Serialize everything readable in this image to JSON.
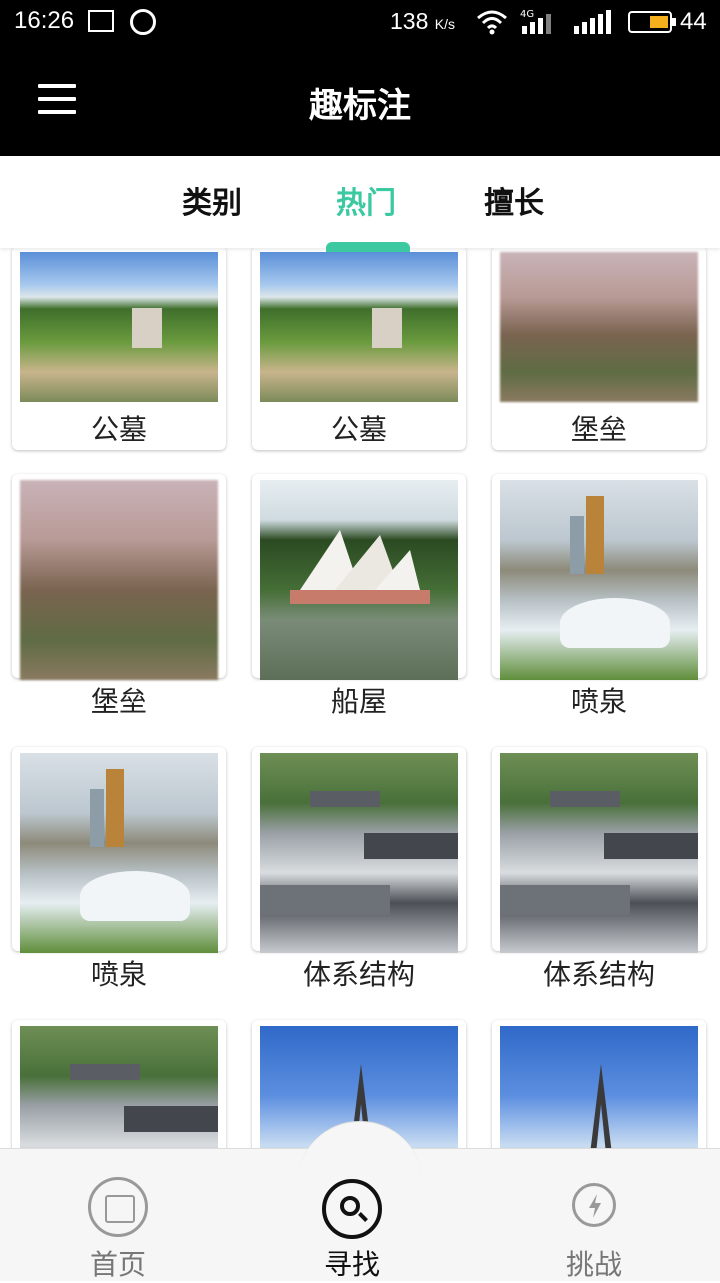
{
  "status_bar": {
    "time": "16:26",
    "network_speed": "138",
    "network_speed_unit": "K/s",
    "network_type": "4G",
    "battery_percent": "44",
    "icons": [
      "image-icon",
      "check-circle-icon",
      "wifi-icon",
      "signal-icon",
      "battery-icon"
    ]
  },
  "app_bar": {
    "title": "趣标注",
    "menu_icon": "hamburger-menu-icon"
  },
  "tabs": [
    {
      "label": "类别",
      "active": false
    },
    {
      "label": "热门",
      "active": true
    },
    {
      "label": "擅长",
      "active": false
    }
  ],
  "accent_color": "#3cc8a0",
  "grid_items": [
    {
      "label": "公墓",
      "thumb": "arch"
    },
    {
      "label": "公墓",
      "thumb": "arch"
    },
    {
      "label": "堡垒",
      "thumb": "blur"
    },
    {
      "label": "堡垒",
      "thumb": "blur"
    },
    {
      "label": "船屋",
      "thumb": "opera"
    },
    {
      "label": "喷泉",
      "thumb": "fountain"
    },
    {
      "label": "喷泉",
      "thumb": "fountain"
    },
    {
      "label": "体系结构",
      "thumb": "temple"
    },
    {
      "label": "体系结构",
      "thumb": "temple"
    },
    {
      "label": "",
      "thumb": "temple"
    },
    {
      "label": "",
      "thumb": "eiffel"
    },
    {
      "label": "",
      "thumb": "eiffel"
    }
  ],
  "bottom_nav": [
    {
      "label": "首页",
      "icon": "picture-frame-icon",
      "active": false
    },
    {
      "label": "寻找",
      "icon": "search-icon",
      "active": true
    },
    {
      "label": "挑战",
      "icon": "lightning-refresh-icon",
      "active": false
    }
  ]
}
